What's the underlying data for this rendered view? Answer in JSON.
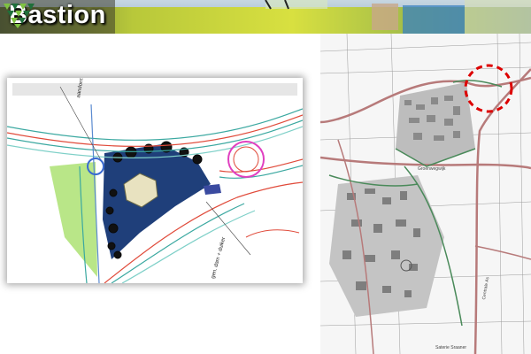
{
  "header": {
    "title": "Bastion",
    "colors": {
      "sky": "#9bb6c8",
      "field": "#cfd93a",
      "title": "#ffffff",
      "logo_green": "#7fc241",
      "logo_dark": "#1f6f3a"
    }
  },
  "plan": {
    "label_top": "aandorm",
    "label_bottom": "gen. dam + duiker",
    "colors": {
      "water": "#1f3f7a",
      "grass": "#a8e06a",
      "road": "#e04a3a",
      "alt_road": "#3aa8a0",
      "magenta": "#e040c0"
    }
  },
  "map": {
    "highlight_color": "#dd0000",
    "labels": [
      "Groenwegwijk",
      "Centrale As",
      "Saterie Sraaner"
    ]
  }
}
